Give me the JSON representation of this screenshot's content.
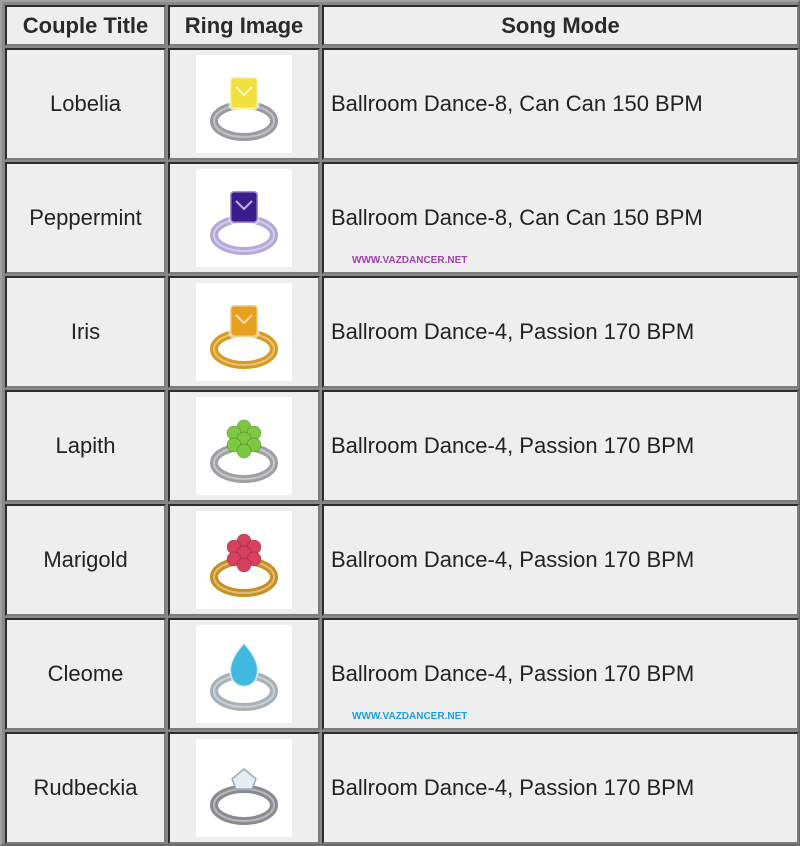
{
  "headers": {
    "couple_title": "Couple Title",
    "ring_image": "Ring Image",
    "song_mode": "Song Mode"
  },
  "rows": [
    {
      "title": "Lobelia",
      "ring": "yellow-gem-silver-ring-icon",
      "mode": "Ballroom Dance-8, Can Can 150 BPM",
      "gem_color": "#f2e040",
      "band_color": "#9a9aa0"
    },
    {
      "title": "Peppermint",
      "ring": "purple-gem-silver-ring-icon",
      "mode": "Ballroom Dance-8, Can Can 150 BPM",
      "gem_color": "#3a1c8c",
      "band_color": "#b4a8d8",
      "watermark": "WWW.VAZDANCER.NET",
      "watermark_color": "#a040b0"
    },
    {
      "title": "Iris",
      "ring": "orange-gem-gold-ring-icon",
      "mode": "Ballroom Dance-4, Passion 170 BPM",
      "gem_color": "#e8a020",
      "band_color": "#d89a20"
    },
    {
      "title": "Lapith",
      "ring": "green-cluster-silver-ring-icon",
      "mode": "Ballroom Dance-4, Passion 170 BPM",
      "gem_color": "#7cc840",
      "band_color": "#a0a0a4"
    },
    {
      "title": "Marigold",
      "ring": "red-cluster-gold-ring-icon",
      "mode": "Ballroom Dance-4, Passion 170 BPM",
      "gem_color": "#d84060",
      "band_color": "#c89020"
    },
    {
      "title": "Cleome",
      "ring": "blue-teardrop-silver-ring-icon",
      "mode": "Ballroom Dance-4, Passion 170 BPM",
      "gem_color": "#40b8e0",
      "band_color": "#a8b0b8",
      "watermark": "WWW.VAZDANCER.NET",
      "watermark_color": "#1aa0e0"
    },
    {
      "title": "Rudbeckia",
      "ring": "clear-gem-silver-ring-icon",
      "mode": "Ballroom Dance-4, Passion 170 BPM",
      "gem_color": "#e4eef4",
      "band_color": "#8a8a90"
    }
  ]
}
